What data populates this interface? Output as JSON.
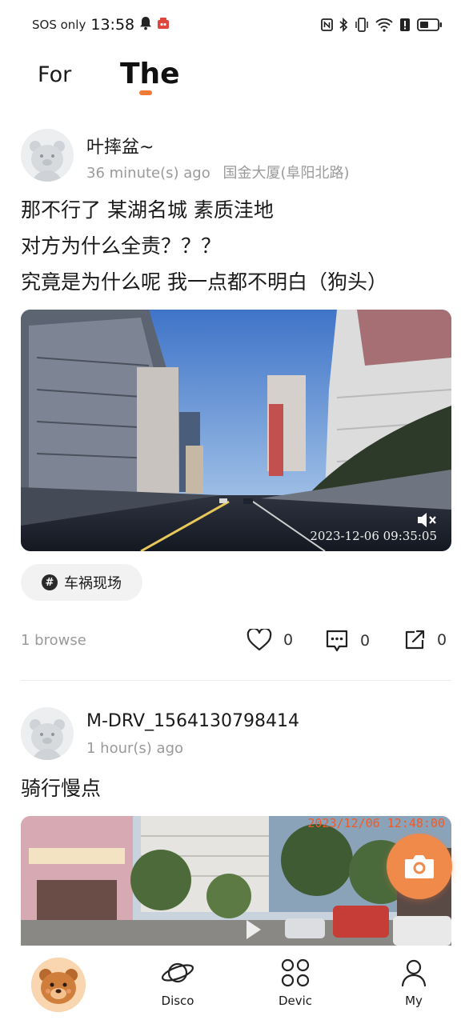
{
  "status_bar": {
    "carrier": "SOS only",
    "time": "13:58",
    "icons": [
      "bell-icon",
      "app-notification-icon",
      "nfc-icon",
      "bluetooth-icon",
      "vibrate-icon",
      "wifi-icon",
      "alert-icon",
      "battery-icon"
    ],
    "battery_level": 0.5
  },
  "top_tabs": {
    "items": [
      {
        "label": "For",
        "active": false
      },
      {
        "label": "The",
        "active": true
      }
    ],
    "indicator_color": "#f07a35"
  },
  "posts": [
    {
      "username": "叶摔盆~",
      "time_ago": "36 minute(s) ago",
      "location": "国金大厦(阜阳北路)",
      "content_lines": [
        "那不行了 某湖名城 素质洼地",
        "对方为什么全责？？？",
        "究竟是为什么呢 我一点都不明白（狗头）"
      ],
      "media_timestamp": "2023-12-06 09:35:05",
      "media_icon": "mute-icon",
      "tag": "车祸现场",
      "browse": "1 browse",
      "likes": "0",
      "comments": "0",
      "shares": "0"
    },
    {
      "username": "M-DRV_1564130798414",
      "time_ago": "1 hour(s) ago",
      "content_lines": [
        "骑行慢点"
      ],
      "media_timestamp": "2023/12/06 12:48:00"
    }
  ],
  "fab": {
    "icon": "camera-icon",
    "color": "#f08a4b"
  },
  "bottom_nav": {
    "home_icon": "bear-mascot-icon",
    "items": [
      {
        "label": "Disco",
        "icon": "planet-icon"
      },
      {
        "label": "Devic",
        "icon": "grid-icon"
      },
      {
        "label": "My",
        "icon": "person-icon"
      }
    ]
  },
  "colors": {
    "accent": "#f07a35",
    "muted_text": "#9a9a9a"
  }
}
